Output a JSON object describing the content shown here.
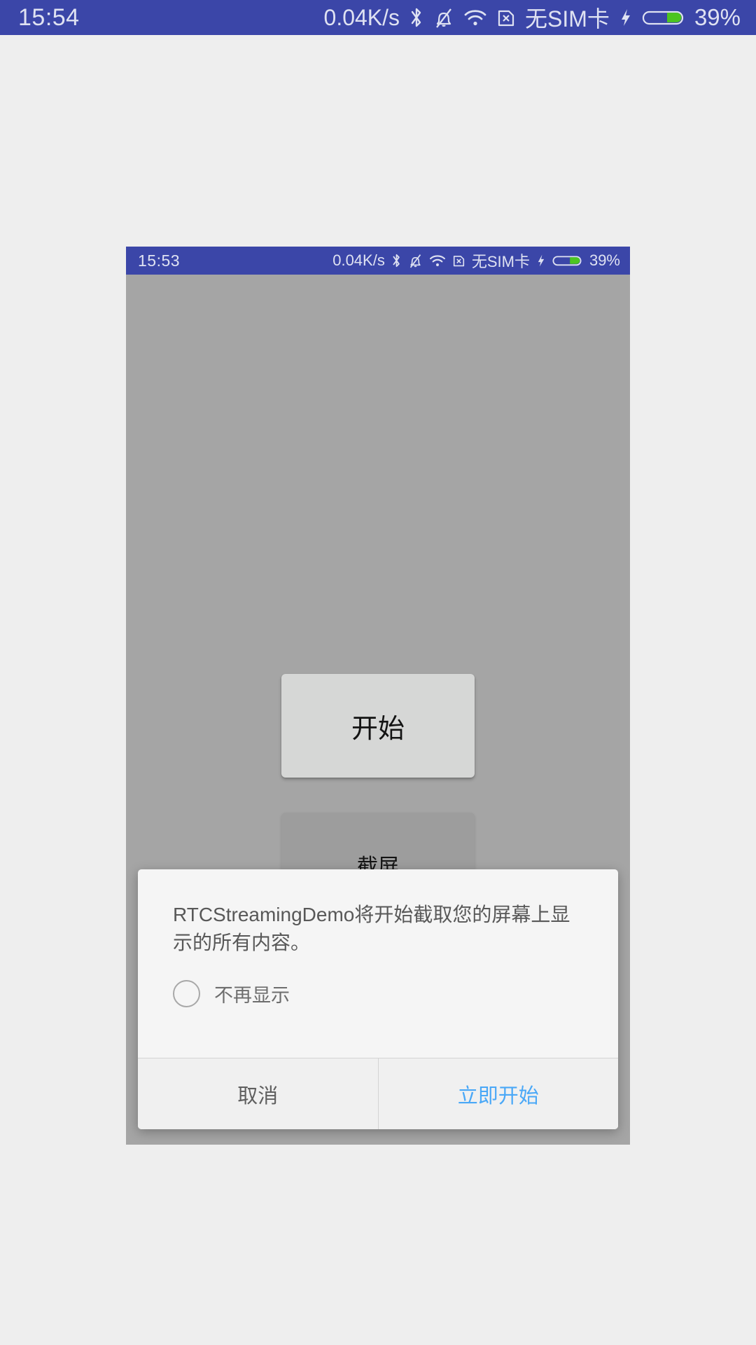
{
  "outer_status_bar": {
    "time": "15:54",
    "net_speed": "0.04K/s",
    "sim_text": "无SIM卡",
    "battery_text": "39%",
    "battery_percent": 39,
    "icons": [
      "bluetooth-icon",
      "mute-bell-icon",
      "wifi-icon",
      "sim-card-off-icon",
      "charging-bolt-icon",
      "battery-icon"
    ],
    "background_color": "#3b46a8",
    "text_color": "#dfe2f2",
    "battery_fill_color": "#4cc520"
  },
  "device": {
    "status_bar": {
      "time": "15:53",
      "net_speed": "0.04K/s",
      "sim_text": "无SIM卡",
      "battery_text": "39%",
      "battery_percent": 39
    },
    "app": {
      "buttons": [
        {
          "label": "开始",
          "name": "start-button"
        },
        {
          "label": "截屏",
          "name": "capture-screen-button"
        }
      ]
    },
    "dialog": {
      "message": "RTCStreamingDemo将开始截取您的屏幕上显示的所有内容。",
      "checkbox_label": "不再显示",
      "checkbox_checked": false,
      "cancel_label": "取消",
      "confirm_label": "立即开始",
      "confirm_color": "#4aa8f7"
    }
  },
  "page": {
    "background_color": "#eeeeee",
    "device_screen_color": "#a5a5a5"
  }
}
